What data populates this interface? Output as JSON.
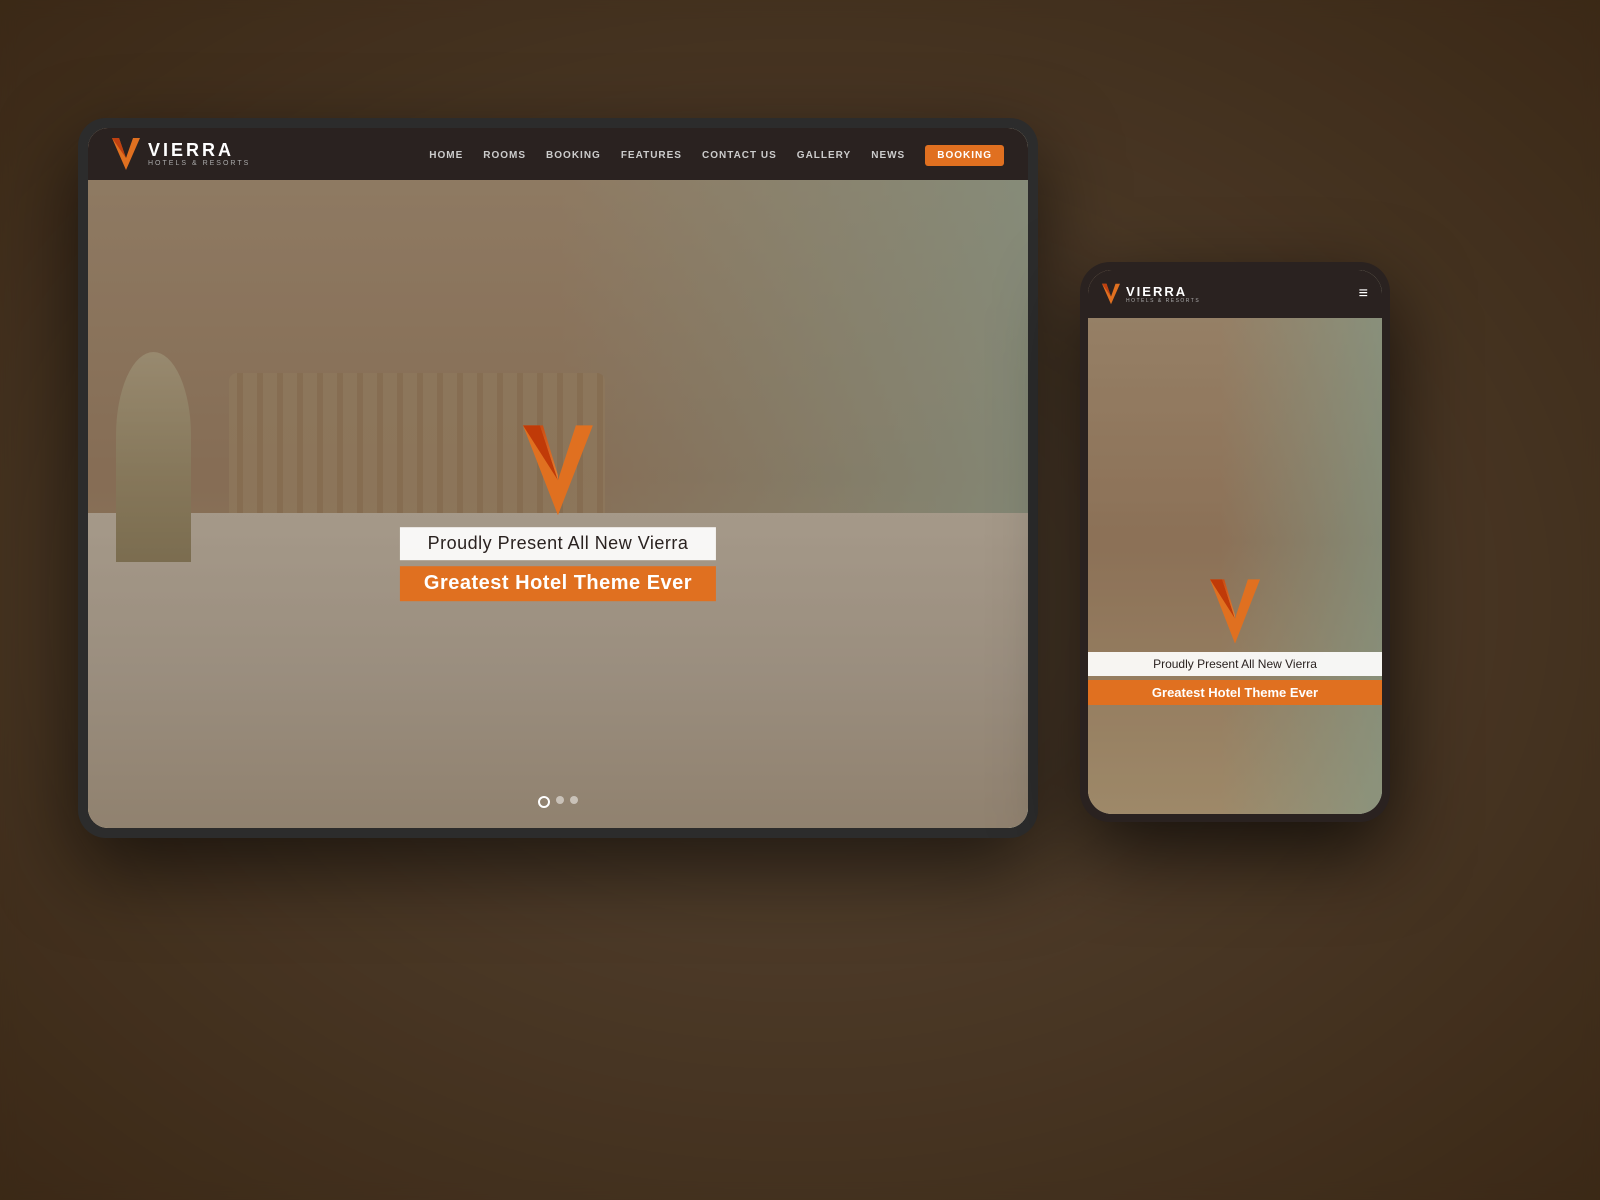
{
  "page": {
    "title": "Vierra Hotels & Resorts"
  },
  "background": {
    "overlay_color": "rgba(60,40,20,0.55)"
  },
  "tablet": {
    "navbar": {
      "logo_name": "VIERRA",
      "logo_subtitle": "HOTELS & RESORTS",
      "nav_items": [
        {
          "label": "HOME",
          "id": "home"
        },
        {
          "label": "ROOMS",
          "id": "rooms"
        },
        {
          "label": "BOOKING",
          "id": "booking"
        },
        {
          "label": "FEATURES",
          "id": "features"
        },
        {
          "label": "CONTACT US",
          "id": "contact"
        },
        {
          "label": "GALLERY",
          "id": "gallery"
        },
        {
          "label": "NEWS",
          "id": "news"
        }
      ],
      "booking_button": "BOOKING"
    },
    "hero": {
      "tagline": "Proudly Present All New Vierra",
      "headline": "Greatest Hotel Theme Ever"
    },
    "slider_dots": 3
  },
  "mobile": {
    "navbar": {
      "logo_name": "VIERRA",
      "logo_subtitle": "HOTELS & RESORTS",
      "menu_icon": "≡"
    },
    "hero": {
      "tagline": "Proudly Present All New Vierra",
      "headline": "Greatest Hotel Theme Ever"
    }
  },
  "colors": {
    "orange": "#e07020",
    "dark": "#2a2220",
    "white": "#ffffff",
    "nav_bg": "#2a2220"
  }
}
